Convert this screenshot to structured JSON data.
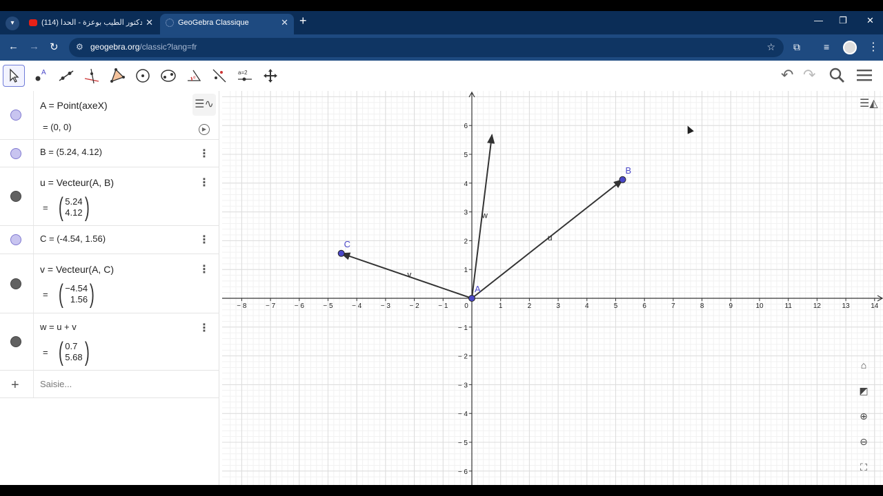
{
  "browser": {
    "tabs": [
      {
        "title": "(114) الدكتور الطيب بوعزة - الحدا",
        "active": false,
        "favicon": "youtube-icon"
      },
      {
        "title": "GeoGebra Classique",
        "active": true,
        "favicon": "geogebra-icon"
      }
    ],
    "url_host": "geogebra.org",
    "url_path": "/classic?lang=fr",
    "colors": {
      "chrome": "#1e4a80",
      "tabstrip": "#0b2d57"
    }
  },
  "toolbar": {
    "tools": [
      "move-tool",
      "point-tool",
      "line-tool",
      "perpendicular-tool",
      "polygon-tool",
      "circle-tool",
      "conic-tool",
      "angle-tool",
      "reflect-tool",
      "slider-tool",
      "move-view-tool"
    ],
    "slider_label": "a=2"
  },
  "algebra": {
    "rows": [
      {
        "def": "A  =  Point(axeX)",
        "val": "=  (0, 0)"
      },
      {
        "def": "B = (5.24,  4.12)"
      },
      {
        "def": "u  =  Vecteur(A, B)",
        "eq": "=",
        "top": "5.24",
        "bottom": "4.12"
      },
      {
        "def": "C = (-4.54,  1.56)"
      },
      {
        "def": "v  =  Vecteur(A, C)",
        "eq": "=",
        "top": "−4.54",
        "bottom": "1.56"
      },
      {
        "def": "w  =  u + v",
        "eq": "=",
        "top": "0.7",
        "bottom": "5.68"
      }
    ],
    "input_placeholder": "Saisie..."
  },
  "chart_data": {
    "type": "scatter",
    "title": "",
    "xlabel": "",
    "ylabel": "",
    "xlim": [
      -8.5,
      14.2
    ],
    "ylim": [
      -6.3,
      7.0
    ],
    "grid": true,
    "x_ticks": [
      -8,
      -7,
      -6,
      -5,
      -4,
      -3,
      -2,
      -1,
      0,
      1,
      2,
      3,
      4,
      5,
      6,
      7,
      8,
      9,
      10,
      11,
      12,
      13,
      14
    ],
    "y_ticks": [
      -6,
      -5,
      -4,
      -3,
      -2,
      -1,
      1,
      2,
      3,
      4,
      5,
      6
    ],
    "points": [
      {
        "name": "A",
        "x": 0,
        "y": 0
      },
      {
        "name": "B",
        "x": 5.24,
        "y": 4.12
      },
      {
        "name": "C",
        "x": -4.54,
        "y": 1.56
      }
    ],
    "vectors": [
      {
        "name": "u",
        "from": [
          0,
          0
        ],
        "to": [
          5.24,
          4.12
        ]
      },
      {
        "name": "v",
        "from": [
          0,
          0
        ],
        "to": [
          -4.54,
          1.56
        ]
      },
      {
        "name": "w",
        "from": [
          0,
          0
        ],
        "to": [
          0.7,
          5.68
        ]
      }
    ],
    "colors": {
      "point": "#4a47c8",
      "vector": "#333333",
      "grid": "#e6e6e6"
    }
  }
}
